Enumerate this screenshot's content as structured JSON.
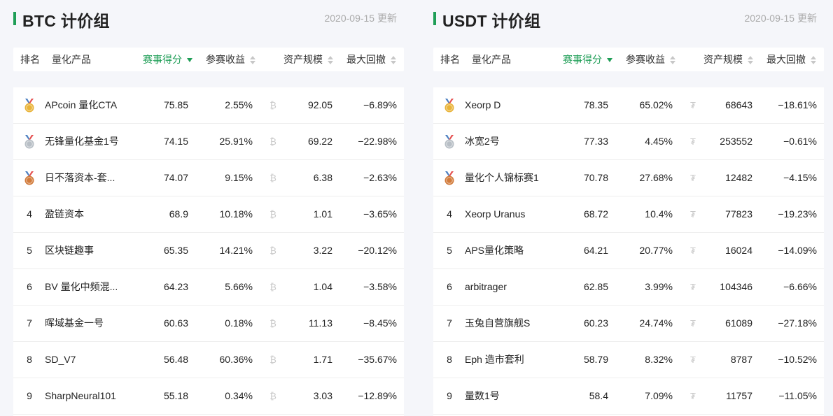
{
  "colors": {
    "accent": "#1f9e57",
    "gold": "#e9b43a",
    "silver": "#b8bfc6",
    "bronze": "#d27b3b"
  },
  "headers": {
    "rank": "排名",
    "product": "量化产品",
    "score": "赛事得分",
    "return": "参赛收益",
    "aum": "资产规模",
    "drawdown": "最大回撤"
  },
  "panels": [
    {
      "title": "BTC 计价组",
      "date": "2020-09-15 更新",
      "coin_glyph": "₿",
      "rows": [
        {
          "rank": "1",
          "medal": "gold",
          "name": "APcoin 量化CTA",
          "score": "75.85",
          "return": "2.55%",
          "aum": "92.05",
          "drawdown": "−6.89%"
        },
        {
          "rank": "2",
          "medal": "silver",
          "name": "无锋量化基金1号",
          "score": "74.15",
          "return": "25.91%",
          "aum": "69.22",
          "drawdown": "−22.98%"
        },
        {
          "rank": "3",
          "medal": "bronze",
          "name": "日不落资本-套...",
          "score": "74.07",
          "return": "9.15%",
          "aum": "6.38",
          "drawdown": "−2.63%"
        },
        {
          "rank": "4",
          "medal": "",
          "name": "盈链资本",
          "score": "68.9",
          "return": "10.18%",
          "aum": "1.01",
          "drawdown": "−3.65%"
        },
        {
          "rank": "5",
          "medal": "",
          "name": "区块链趣事",
          "score": "65.35",
          "return": "14.21%",
          "aum": "3.22",
          "drawdown": "−20.12%"
        },
        {
          "rank": "6",
          "medal": "",
          "name": "BV 量化中频混...",
          "score": "64.23",
          "return": "5.66%",
          "aum": "1.04",
          "drawdown": "−3.58%"
        },
        {
          "rank": "7",
          "medal": "",
          "name": "晖域基金一号",
          "score": "60.63",
          "return": "0.18%",
          "aum": "11.13",
          "drawdown": "−8.45%"
        },
        {
          "rank": "8",
          "medal": "",
          "name": "SD_V7",
          "score": "56.48",
          "return": "60.36%",
          "aum": "1.71",
          "drawdown": "−35.67%"
        },
        {
          "rank": "9",
          "medal": "",
          "name": "SharpNeural101",
          "score": "55.18",
          "return": "0.34%",
          "aum": "3.03",
          "drawdown": "−12.89%"
        }
      ]
    },
    {
      "title": "USDT 计价组",
      "date": "2020-09-15 更新",
      "coin_glyph": "₮",
      "rows": [
        {
          "rank": "1",
          "medal": "gold",
          "name": "Xeorp D",
          "score": "78.35",
          "return": "65.02%",
          "aum": "68643",
          "drawdown": "−18.61%"
        },
        {
          "rank": "2",
          "medal": "silver",
          "name": "冰宽2号",
          "score": "77.33",
          "return": "4.45%",
          "aum": "253552",
          "drawdown": "−0.61%"
        },
        {
          "rank": "3",
          "medal": "bronze",
          "name": "量化个人锦标赛1",
          "score": "70.78",
          "return": "27.68%",
          "aum": "12482",
          "drawdown": "−4.15%"
        },
        {
          "rank": "4",
          "medal": "",
          "name": "Xeorp Uranus",
          "score": "68.72",
          "return": "10.4%",
          "aum": "77823",
          "drawdown": "−19.23%"
        },
        {
          "rank": "5",
          "medal": "",
          "name": "APS量化策略",
          "score": "64.21",
          "return": "20.77%",
          "aum": "16024",
          "drawdown": "−14.09%"
        },
        {
          "rank": "6",
          "medal": "",
          "name": "arbitrager",
          "score": "62.85",
          "return": "3.99%",
          "aum": "104346",
          "drawdown": "−6.66%"
        },
        {
          "rank": "7",
          "medal": "",
          "name": "玉兔自营旗舰S",
          "score": "60.23",
          "return": "24.74%",
          "aum": "61089",
          "drawdown": "−27.18%"
        },
        {
          "rank": "8",
          "medal": "",
          "name": "Eph 造市套利",
          "score": "58.79",
          "return": "8.32%",
          "aum": "8787",
          "drawdown": "−10.52%"
        },
        {
          "rank": "9",
          "medal": "",
          "name": "量数1号",
          "score": "58.4",
          "return": "7.09%",
          "aum": "11757",
          "drawdown": "−11.05%"
        }
      ]
    }
  ]
}
